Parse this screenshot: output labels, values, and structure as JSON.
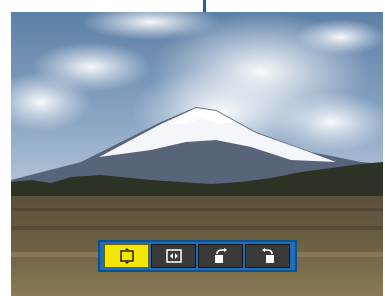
{
  "projector_osd": {
    "toolbar": {
      "buttons": [
        {
          "icon": "frame-fit-icon",
          "state": "selected"
        },
        {
          "icon": "expand-icon",
          "state": "normal"
        },
        {
          "icon": "rotate-right-icon",
          "state": "normal"
        },
        {
          "icon": "rotate-left-icon",
          "state": "normal"
        }
      ]
    },
    "colors": {
      "toolbar_bg": "#1f6fb6",
      "selected_button": "#f3e600",
      "normal_button": "#3a3a3a",
      "pointer": "#1a5fa8"
    }
  }
}
